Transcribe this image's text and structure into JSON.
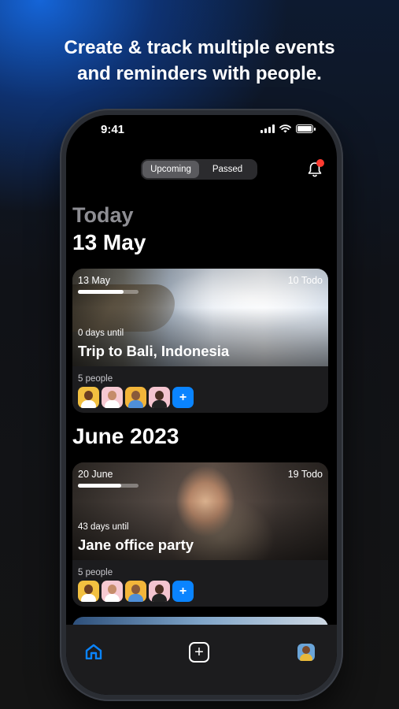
{
  "headline": {
    "line1": "Create & track multiple events",
    "line2": "and reminders with people."
  },
  "status_bar": {
    "time": "9:41",
    "icons": [
      "signal-icon",
      "wifi-icon",
      "battery-icon"
    ]
  },
  "segment": {
    "options": [
      "Upcoming",
      "Passed"
    ],
    "selected": "Upcoming"
  },
  "notification": {
    "icon": "bell-icon",
    "has_badge": true,
    "badge_color": "#ff3b30"
  },
  "sections": [
    {
      "label": "Today",
      "heading": "13 May"
    },
    {
      "heading": "June 2023"
    }
  ],
  "events": [
    {
      "date": "13 May",
      "todo": "10 Todo",
      "progress": 0.75,
      "until": "0 days until",
      "title": "Trip to Bali, Indonesia",
      "people": "5 people",
      "avatars": [
        "avatar-1",
        "avatar-2",
        "avatar-3",
        "avatar-4"
      ]
    },
    {
      "date": "20 June",
      "todo": "19 Todo",
      "progress": 0.72,
      "until": "43 days until",
      "title": "Jane office party",
      "people": "5 people",
      "avatars": [
        "avatar-1",
        "avatar-2",
        "avatar-3",
        "avatar-4"
      ]
    }
  ],
  "add_person_label": "+",
  "tab_bar": {
    "items": [
      "home-icon",
      "add-event-icon",
      "profile-avatar"
    ],
    "active": "home-icon",
    "accent": "#0a84ff"
  }
}
